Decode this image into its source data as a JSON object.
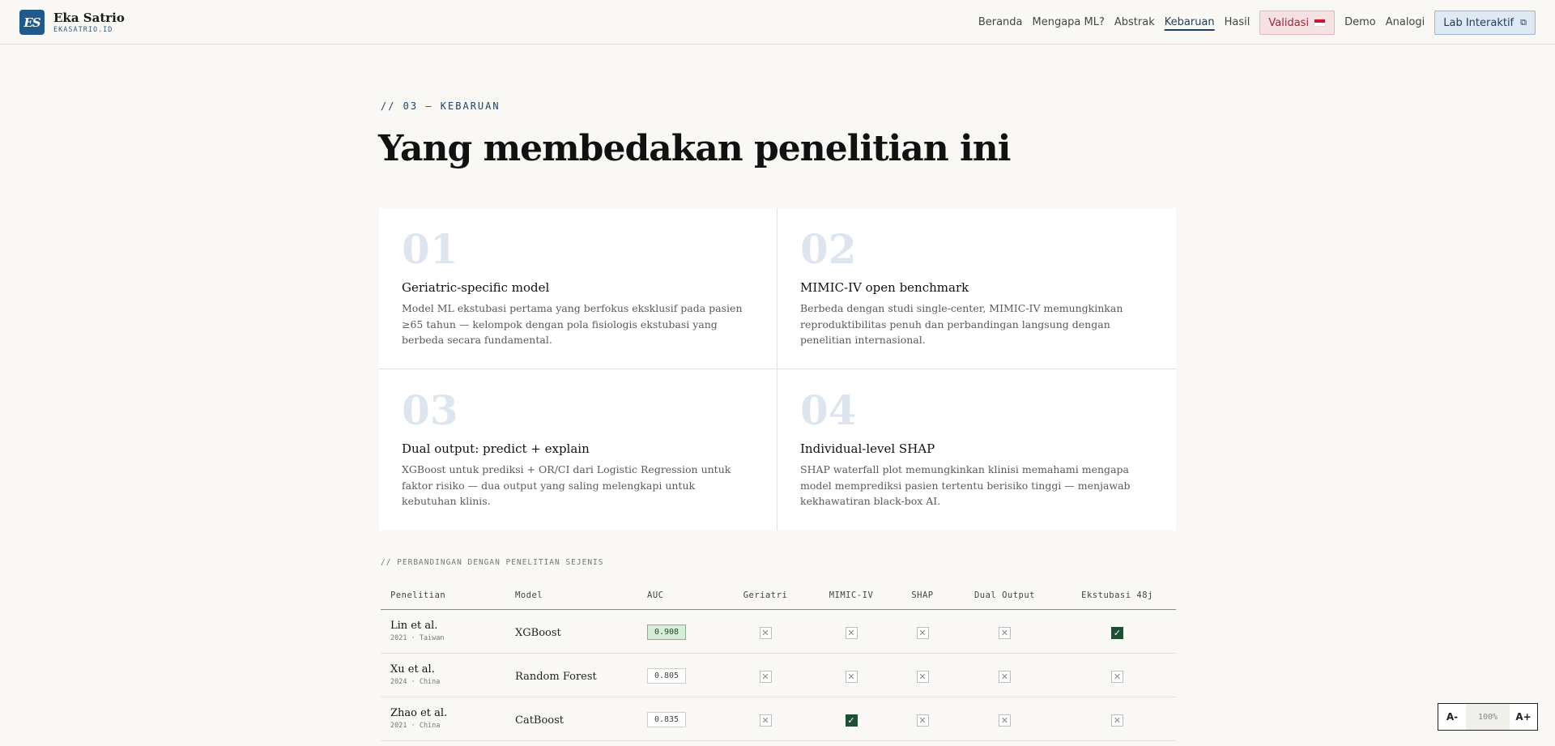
{
  "brand": {
    "badge": "ES",
    "name": "Eka Satrio",
    "domain": "EKASATRIO.ID"
  },
  "nav": {
    "links": [
      "Beranda",
      "Mengapa ML?",
      "Abstrak",
      "Kebaruan",
      "Hasil"
    ],
    "active": "Kebaruan",
    "validasi_label": "Validasi",
    "links_after": [
      "Demo",
      "Analogi"
    ],
    "lab_label": "Lab Interaktif",
    "accent_color": "#1d3c5e",
    "validasi_color": "#a3243a"
  },
  "section": {
    "eyebrow": "// 03 — KEBARUAN",
    "title": "Yang membedakan penelitian ini"
  },
  "cards": [
    {
      "num": "01",
      "title": "Geriatric-specific model",
      "desc": "Model ML ekstubasi pertama yang berfokus eksklusif pada pasien ≥65 tahun — kelompok dengan pola fisiologis ekstubasi yang berbeda secara fundamental."
    },
    {
      "num": "02",
      "title": "MIMIC-IV open benchmark",
      "desc": "Berbeda dengan studi single-center, MIMIC-IV memungkinkan reproduktibilitas penuh dan perbandingan langsung dengan penelitian internasional."
    },
    {
      "num": "03",
      "title": "Dual output: predict + explain",
      "desc": "XGBoost untuk prediksi + OR/CI dari Logistic Regression untuk faktor risiko — dua output yang saling melengkapi untuk kebutuhan klinis."
    },
    {
      "num": "04",
      "title": "Individual-level SHAP",
      "desc": "SHAP waterfall plot memungkinkan klinisi memahami mengapa model memprediksi pasien tertentu berisiko tinggi — menjawab kekhawatiran black-box AI."
    }
  ],
  "comparison": {
    "label": "// PERBANDINGAN DENGAN PENELITIAN SEJENIS",
    "headers": [
      "Penelitian",
      "Model",
      "AUC",
      "Geriatri",
      "MIMIC-IV",
      "SHAP",
      "Dual Output",
      "Ekstubasi 48j"
    ],
    "rows": [
      {
        "study": "Lin et al.",
        "meta": "2021 · Taiwan",
        "model": "XGBoost",
        "auc": "0.908",
        "best": true,
        "geriatri": false,
        "mimic": false,
        "shap": false,
        "dual": false,
        "ext48": true
      },
      {
        "study": "Xu et al.",
        "meta": "2024 · China",
        "model": "Random Forest",
        "auc": "0.805",
        "best": false,
        "geriatri": false,
        "mimic": false,
        "shap": false,
        "dual": false,
        "ext48": false
      },
      {
        "study": "Zhao et al.",
        "meta": "2021 · China",
        "model": "CatBoost",
        "auc": "0.835",
        "best": false,
        "geriatri": false,
        "mimic": true,
        "shap": false,
        "dual": false,
        "ext48": false
      }
    ],
    "yes_glyph": "✓",
    "no_glyph": "✕"
  },
  "font_control": {
    "decrease": "A-",
    "value": "100%",
    "increase": "A+"
  }
}
